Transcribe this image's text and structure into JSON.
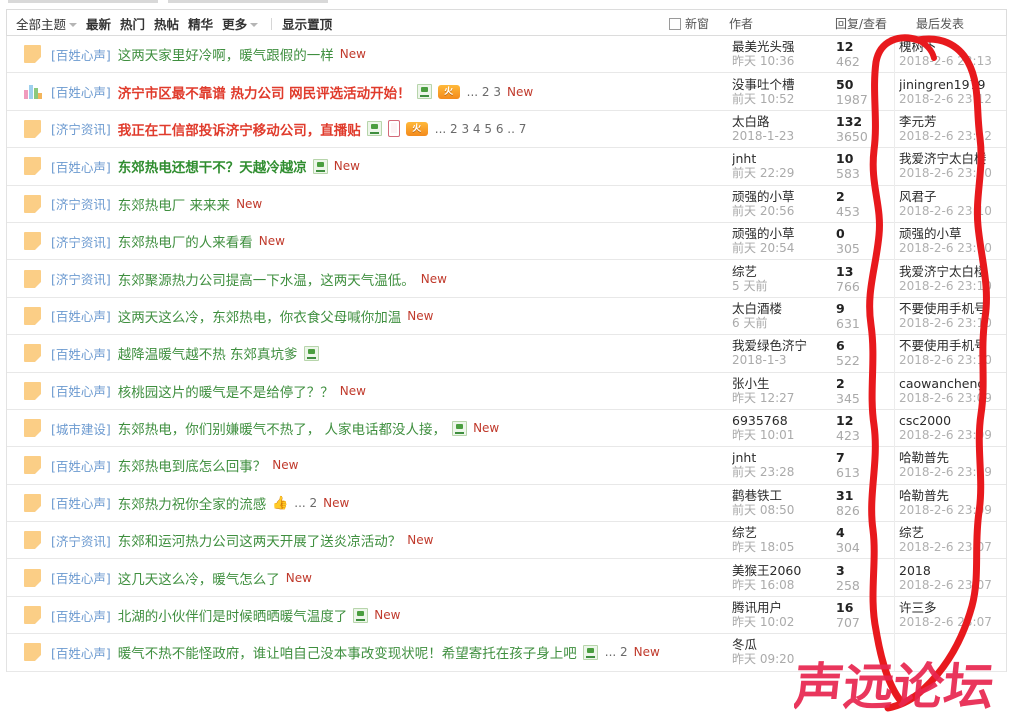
{
  "toolbar": {
    "all_topics": "全部主题",
    "links": [
      "最新",
      "热门",
      "热帖",
      "精华"
    ],
    "more": "更多",
    "show_sticky": "显示置顶",
    "new_window": "新窗",
    "col_author": "作者",
    "col_reply_view": "回复/查看",
    "col_last_post": "最后发表"
  },
  "colors": {
    "title_green": "#3f8f3f",
    "title_red": "#e03b2c",
    "forum_tag": "#6c9ad0",
    "new_badge": "#c0392b",
    "annotation_red": "#e8191d",
    "folder_icon": "#fbce86"
  },
  "rows": [
    {
      "icon": "folder-icon",
      "forum": "[百姓心声]",
      "title": "这两天家里好冷啊，暖气跟假的一样",
      "style": "green",
      "icons": [],
      "pages": "",
      "new": "New",
      "author": "最美光头强",
      "author_date": "昨天 10:36",
      "replies": "12",
      "views": "462",
      "last_author": "槐树下",
      "last_date": "2018-2-6 23:13"
    },
    {
      "icon": "poll-icon",
      "forum": "[百姓心声]",
      "title": "济宁市区最不靠谱 热力公司 网民评选活动开始！",
      "style": "red",
      "icons": [
        "attach",
        "hot"
      ],
      "pages": "... 2 3",
      "new": "New",
      "author": "没事吐个槽",
      "author_date": "前天 10:52",
      "replies": "50",
      "views": "1987",
      "last_author": "jiningren1979",
      "last_date": "2018-2-6 23:12"
    },
    {
      "icon": "folder-icon",
      "forum": "[济宁资讯]",
      "title": "我正在工信部投诉济宁移动公司，直播贴",
      "style": "red",
      "icons": [
        "attach",
        "mobile",
        "hot"
      ],
      "pages": "... 2 3 4 5 6 .. 7",
      "new": "",
      "author": "太白路",
      "author_date": "2018-1-23",
      "replies": "132",
      "views": "3650",
      "last_author": "李元芳",
      "last_date": "2018-2-6 23:12"
    },
    {
      "icon": "folder-icon",
      "forum": "[百姓心声]",
      "title": "东郊热电还想干不？天越冷越凉",
      "style": "greenb",
      "icons": [
        "attach"
      ],
      "pages": "",
      "new": "New",
      "author": "jnht",
      "author_date": "前天 22:29",
      "replies": "10",
      "views": "583",
      "last_author": "我爱济宁太白楼",
      "last_date": "2018-2-6 23:10"
    },
    {
      "icon": "folder-icon",
      "forum": "[济宁资讯]",
      "title": "东郊热电厂 来来来",
      "style": "green",
      "icons": [],
      "pages": "",
      "new": "New",
      "author": "顽强的小草",
      "author_date": "前天 20:56",
      "replies": "2",
      "views": "453",
      "last_author": "风君子",
      "last_date": "2018-2-6 23:10"
    },
    {
      "icon": "folder-icon",
      "forum": "[济宁资讯]",
      "title": "东郊热电厂的人来看看",
      "style": "green",
      "icons": [],
      "pages": "",
      "new": "New",
      "author": "顽强的小草",
      "author_date": "前天 20:54",
      "replies": "0",
      "views": "305",
      "last_author": "顽强的小草",
      "last_date": "2018-2-6 23:10"
    },
    {
      "icon": "folder-icon",
      "forum": "[济宁资讯]",
      "title": "东郊聚源热力公司提高一下水温，这两天气温低。",
      "style": "green",
      "icons": [],
      "pages": "",
      "new": "New",
      "author": "综艺",
      "author_date": "5 天前",
      "replies": "13",
      "views": "766",
      "last_author": "我爱济宁太白楼",
      "last_date": "2018-2-6 23:10"
    },
    {
      "icon": "folder-icon",
      "forum": "[百姓心声]",
      "title": "这两天这么冷，东郊热电，你衣食父母喊你加温",
      "style": "green",
      "icons": [],
      "pages": "",
      "new": "New",
      "author": "太白酒楼",
      "author_date": "6 天前",
      "replies": "9",
      "views": "631",
      "last_author": "不要使用手机号",
      "last_date": "2018-2-6 23:10"
    },
    {
      "icon": "folder-icon",
      "forum": "[百姓心声]",
      "title": "越降温暖气越不热 东郊真坑爹",
      "style": "green",
      "icons": [
        "attach"
      ],
      "pages": "",
      "new": "",
      "author": "我爱绿色济宁",
      "author_date": "2018-1-3",
      "replies": "6",
      "views": "522",
      "last_author": "不要使用手机号",
      "last_date": "2018-2-6 23:10"
    },
    {
      "icon": "folder-icon",
      "forum": "[百姓心声]",
      "title": "核桃园这片的暖气是不是给停了？？",
      "style": "green",
      "icons": [],
      "pages": "",
      "new": "New",
      "author": "张小生",
      "author_date": "昨天 12:27",
      "replies": "2",
      "views": "345",
      "last_author": "caowancheng",
      "last_date": "2018-2-6 23:09"
    },
    {
      "icon": "folder-icon",
      "forum": "[城市建设]",
      "title": "东郊热电，你们别嫌暖气不热了， 人家电话都没人接，",
      "style": "green",
      "icons": [
        "attach"
      ],
      "pages": "",
      "new": "New",
      "author": "6935768",
      "author_date": "昨天 10:01",
      "replies": "12",
      "views": "423",
      "last_author": "csc2000",
      "last_date": "2018-2-6 23:09"
    },
    {
      "icon": "folder-icon",
      "forum": "[百姓心声]",
      "title": "东郊热电到底怎么回事？",
      "style": "green",
      "icons": [],
      "pages": "",
      "new": "New",
      "author": "jnht",
      "author_date": "前天 23:28",
      "replies": "7",
      "views": "613",
      "last_author": "哈勒普先",
      "last_date": "2018-2-6 23:09"
    },
    {
      "icon": "folder-icon",
      "forum": "[百姓心声]",
      "title": "东郊热力祝你全家的流感",
      "style": "green",
      "icons": [
        "thumb"
      ],
      "pages": "... 2",
      "new": "New",
      "author": "鹳巷铁工",
      "author_date": "前天 08:50",
      "replies": "31",
      "views": "826",
      "last_author": "哈勒普先",
      "last_date": "2018-2-6 23:09"
    },
    {
      "icon": "folder-icon",
      "forum": "[济宁资讯]",
      "title": "东郊和运河热力公司这两天开展了送炎凉活动？",
      "style": "green",
      "icons": [],
      "pages": "",
      "new": "New",
      "author": "综艺",
      "author_date": "昨天 18:05",
      "replies": "4",
      "views": "304",
      "last_author": "综艺",
      "last_date": "2018-2-6 23:07"
    },
    {
      "icon": "folder-icon",
      "forum": "[百姓心声]",
      "title": "这几天这么冷，暖气怎么了",
      "style": "green",
      "icons": [],
      "pages": "",
      "new": "New",
      "author": "美猴王2060",
      "author_date": "昨天 16:08",
      "replies": "3",
      "views": "258",
      "last_author": "2018",
      "last_date": "2018-2-6 23:07"
    },
    {
      "icon": "folder-icon",
      "forum": "[百姓心声]",
      "title": "北湖的小伙伴们是时候晒晒暖气温度了",
      "style": "green",
      "icons": [
        "attach"
      ],
      "pages": "",
      "new": "New",
      "author": "腾讯用户",
      "author_date": "昨天 10:02",
      "replies": "16",
      "views": "707",
      "last_author": "许三多",
      "last_date": "2018-2-6 23:07"
    },
    {
      "icon": "folder-icon",
      "forum": "[百姓心声]",
      "title": "暖气不热不能怪政府，谁让咱自己没本事改变现状呢！希望寄托在孩子身上吧",
      "style": "green",
      "icons": [
        "attach"
      ],
      "pages": "... 2",
      "new": "New",
      "author": "冬瓜",
      "author_date": "昨天 09:20",
      "replies": "",
      "views": "",
      "last_author": "",
      "last_date": ""
    }
  ],
  "annotation": {
    "type": "hand-drawn-red-circle",
    "color": "#e8191d"
  },
  "watermark": {
    "text": "声远论坛",
    "color": "#e8254f"
  }
}
